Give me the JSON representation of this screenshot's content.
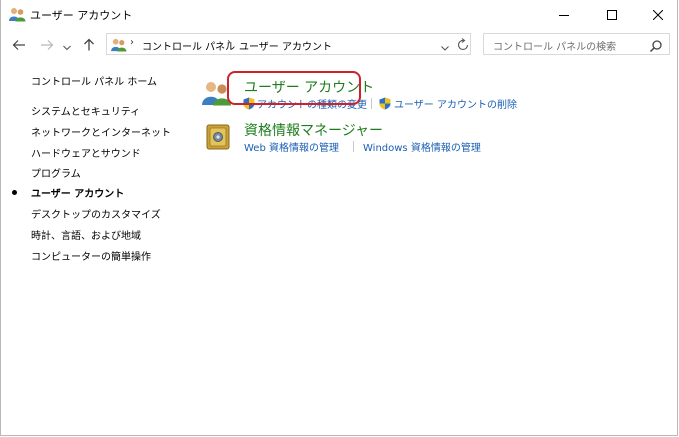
{
  "window": {
    "title": "ユーザー アカウント"
  },
  "nav": {
    "breadcrumbs": [
      "コントロール パネル",
      "ユーザー アカウント"
    ],
    "search_placeholder": "コントロール パネルの検索"
  },
  "left_pane": {
    "items": [
      {
        "label": "コントロール パネル ホーム"
      },
      {
        "label": "システムとセキュリティ"
      },
      {
        "label": "ネットワークとインターネット"
      },
      {
        "label": "ハードウェアとサウンド"
      },
      {
        "label": "プログラム"
      },
      {
        "label": "ユーザー アカウント",
        "current": true
      },
      {
        "label": "デスクトップのカスタマイズ"
      },
      {
        "label": "時計、言語、および地域"
      },
      {
        "label": "コンピューターの簡単操作"
      }
    ]
  },
  "categories": [
    {
      "title": "ユーザー アカウント",
      "links": [
        "アカウントの種類の変更",
        "ユーザー アカウントの削除"
      ]
    },
    {
      "title": "資格情報マネージャー",
      "links": [
        "Web 資格情報の管理",
        "Windows 資格情報の管理"
      ]
    }
  ],
  "colors": {
    "category_title": "#1e7d1e",
    "link": "#1a5fb4",
    "highlight_border": "#d0202a"
  },
  "icons": {
    "title": "users-icon",
    "category_user_accounts": "users-icon",
    "category_credential_manager": "vault-icon",
    "link_shield": "uac-shield-icon"
  }
}
